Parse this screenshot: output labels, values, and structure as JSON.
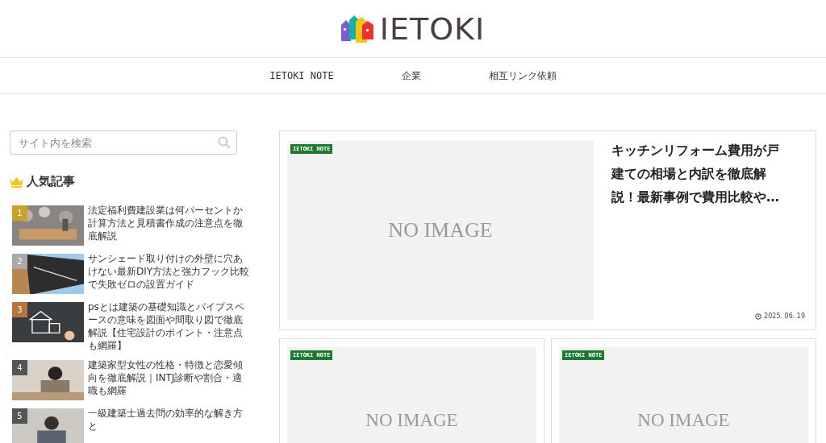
{
  "header": {
    "logo_text": "IETOKI"
  },
  "nav": {
    "items": [
      {
        "label": "IETOKI NOTE"
      },
      {
        "label": "企業"
      },
      {
        "label": "相互リンク依頼"
      }
    ]
  },
  "sidebar": {
    "search": {
      "placeholder": "サイト内を検索"
    },
    "popular": {
      "title": "人気記事",
      "items": [
        {
          "rank": "1",
          "color": "#c9a227",
          "title": "法定福利費建設業は何パーセントか計算方法と見積書作成の注意点を徹底解説"
        },
        {
          "rank": "2",
          "color": "#a9a9a9",
          "title": "サンシェード取り付けの外壁に穴あけない最新DIY方法と強力フック比較で失敗ゼロの設置ガイド"
        },
        {
          "rank": "3",
          "color": "#b5773f",
          "title": "psとは建築の基礎知識とパイプスペースの意味を図面や間取り図で徹底解説【住宅設計のポイント・注意点も網羅】"
        },
        {
          "rank": "4",
          "color": "#555555",
          "title": "建築家型女性の性格・特徴と恋愛傾向を徹底解説｜INTJ診断や割合・適職も網羅"
        },
        {
          "rank": "5",
          "color": "#555555",
          "title": "一級建築士過去問の効率的な解き方と"
        }
      ]
    }
  },
  "main": {
    "featured": {
      "category": "IETOKI NOTE",
      "image_text": "NO IMAGE",
      "title": "キッチンリフォーム費用が戸建ての相場と内訳を徹底解説！最新事例で費用比較や…",
      "date": "2025. 06. 19"
    },
    "cards": [
      {
        "category": "IETOKI NOTE",
        "image_text": "NO IMAGE"
      },
      {
        "category": "IETOKI NOTE",
        "image_text": "NO IMAGE"
      }
    ]
  }
}
